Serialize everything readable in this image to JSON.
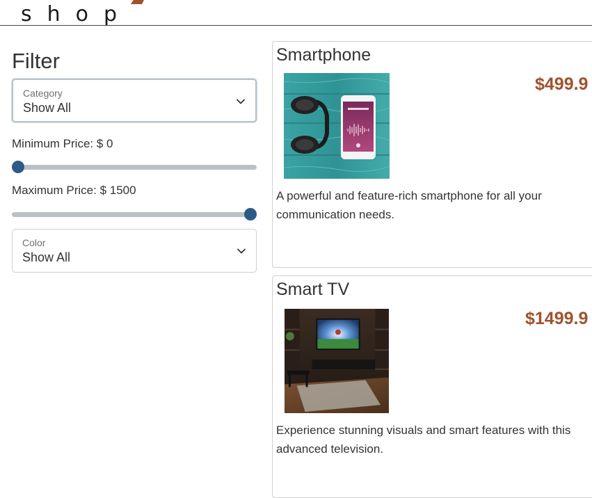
{
  "header": {
    "logo_text": "shop"
  },
  "colors": {
    "accent": "#a0522d",
    "slider_thumb": "#2e5a87",
    "slider_track": "#b9c1c6"
  },
  "sidebar": {
    "title": "Filter",
    "category": {
      "label": "Category",
      "value": "Show All"
    },
    "min_price": {
      "label": "Minimum Price: $ 0",
      "value": 0
    },
    "max_price": {
      "label": "Maximum Price: $ 1500",
      "value": 1500
    },
    "color": {
      "label": "Color",
      "value": "Show All"
    }
  },
  "products": [
    {
      "name": "Smartphone",
      "price": "$499.9",
      "description": "A powerful and feature-rich smartphone for all your communication needs.",
      "image_icon": "smartphone-headphones-image"
    },
    {
      "name": "Smart TV",
      "price": "$1499.9",
      "description": "Experience stunning visuals and smart features with this advanced television.",
      "image_icon": "smart-tv-living-room-image"
    }
  ]
}
